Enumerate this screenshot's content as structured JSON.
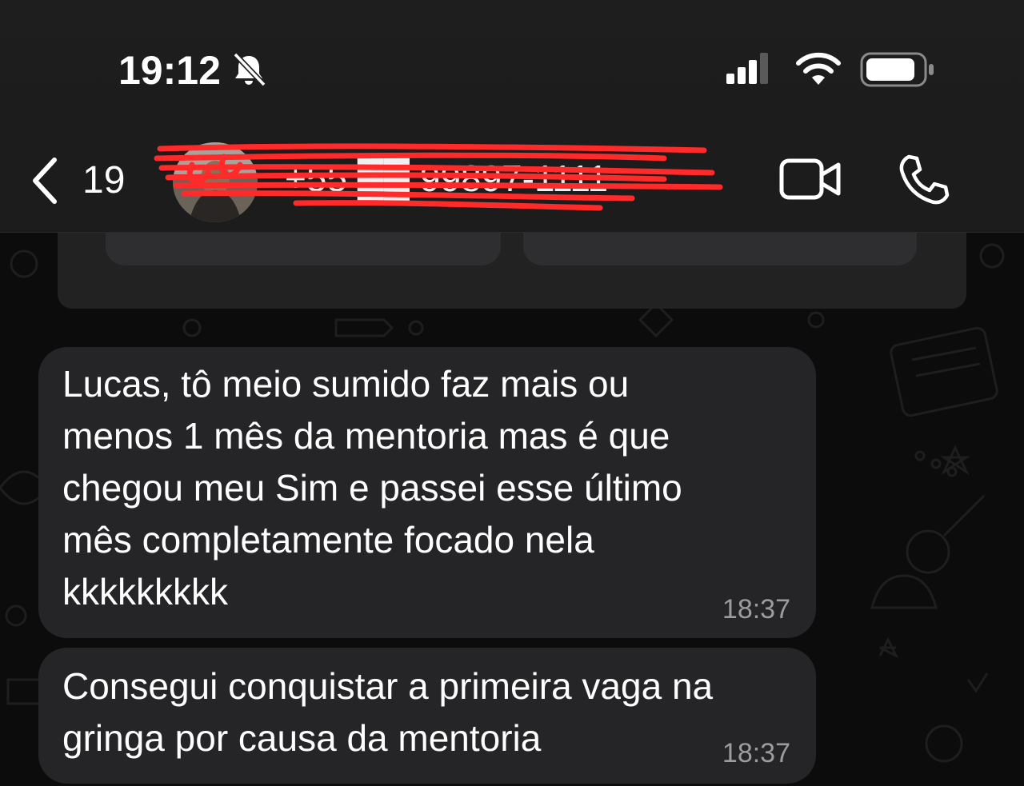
{
  "status_bar": {
    "time": "19:12",
    "icons": [
      "bell-slash-icon",
      "cellular-signal-icon",
      "wifi-icon",
      "battery-icon"
    ]
  },
  "header": {
    "back_count": "19",
    "contact_name": "+55 ██ 99897-1111",
    "icons": [
      "chevron-left-icon",
      "video-camera-icon",
      "phone-icon"
    ]
  },
  "messages": [
    {
      "text": "Lucas, tô meio sumido faz mais ou\nmenos 1 mês da mentoria mas é que\nchegou meu Sim e passei esse último\nmês completamente focado nela\nkkkkkkkkk",
      "time": "18:37"
    },
    {
      "text": "Consegui conquistar a primeira vaga na\ngringa por causa da mentoria",
      "time": "18:37"
    }
  ],
  "colors": {
    "bar_bg": "#1c1c1c",
    "chat_bg": "#0c0c0c",
    "bubble_bg": "#252527",
    "timestamp": "#9c9c9e",
    "redaction": "#ff2a2a"
  }
}
